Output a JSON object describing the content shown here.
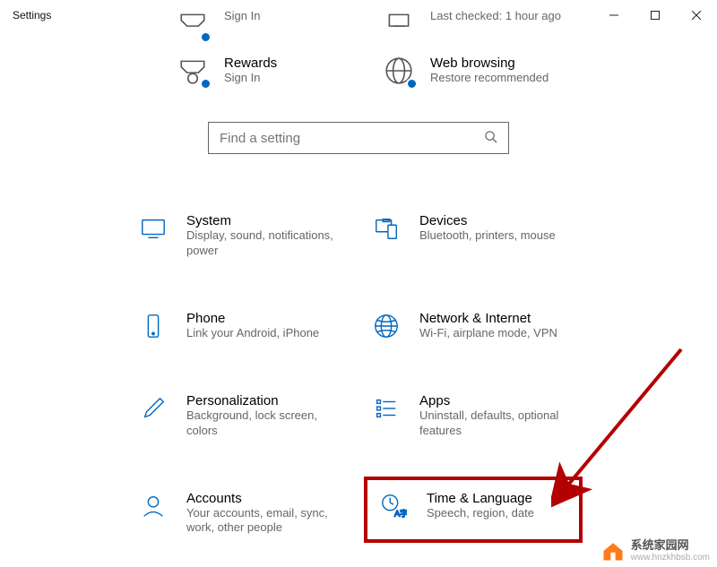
{
  "window": {
    "title": "Settings"
  },
  "statusTop": [
    {
      "title": "",
      "sub": "Sign In",
      "iconName": "rewards-cutoff-icon"
    },
    {
      "title": "",
      "sub": "Last checked: 1 hour ago",
      "iconName": "update-cutoff-icon"
    }
  ],
  "statusCards": [
    {
      "title": "Rewards",
      "sub": "Sign In",
      "iconName": "rewards-icon"
    },
    {
      "title": "Web browsing",
      "sub": "Restore recommended",
      "iconName": "globe-icon"
    }
  ],
  "search": {
    "placeholder": "Find a setting"
  },
  "categories": [
    [
      {
        "title": "System",
        "sub": "Display, sound, notifications, power",
        "iconName": "system-icon"
      },
      {
        "title": "Devices",
        "sub": "Bluetooth, printers, mouse",
        "iconName": "devices-icon"
      }
    ],
    [
      {
        "title": "Phone",
        "sub": "Link your Android, iPhone",
        "iconName": "phone-icon"
      },
      {
        "title": "Network & Internet",
        "sub": "Wi-Fi, airplane mode, VPN",
        "iconName": "network-icon"
      }
    ],
    [
      {
        "title": "Personalization",
        "sub": "Background, lock screen, colors",
        "iconName": "personalization-icon"
      },
      {
        "title": "Apps",
        "sub": "Uninstall, defaults, optional features",
        "iconName": "apps-icon"
      }
    ],
    [
      {
        "title": "Accounts",
        "sub": "Your accounts, email, sync, work, other people",
        "iconName": "accounts-icon"
      },
      {
        "title": "Time & Language",
        "sub": "Speech, region, date",
        "iconName": "time-language-icon",
        "highlight": true
      }
    ]
  ],
  "watermark": {
    "text": "系统家园网",
    "url": "www.hnzkhbsb.com"
  }
}
